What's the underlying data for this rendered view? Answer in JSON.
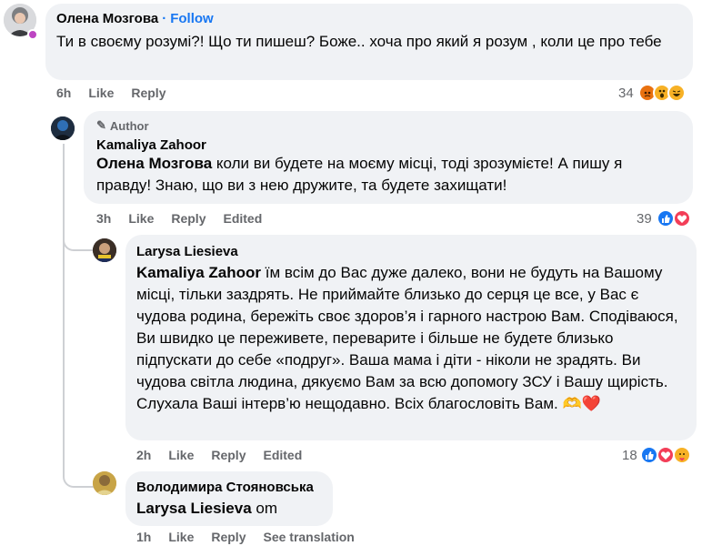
{
  "comments": [
    {
      "author": "Олена Мозгова",
      "follow": "Follow",
      "text": "Ти в своєму розумі?! Що ти пишеш? Боже.. хоча про який я розум , коли це про тебе",
      "time": "6h",
      "like": "Like",
      "reply": "Reply",
      "reactions_count": "34",
      "reactions": [
        "angry",
        "wow",
        "haha"
      ]
    },
    {
      "badge": "Author",
      "author": "Kamaliya Zahoor",
      "mention": "Олена Мозгова",
      "text": " коли ви будете на моєму місці, тоді зрозумієте! А пишу я правду! Знаю, що ви з нею дружите, та будете захищати!",
      "time": "3h",
      "like": "Like",
      "reply": "Reply",
      "edited": "Edited",
      "reactions_count": "39",
      "reactions": [
        "like",
        "love"
      ]
    },
    {
      "author": "Larysa Liesieva",
      "mention": "Kamaliya Zahoor",
      "text": " їм всім до Вас дуже далеко, вони не будуть на Вашому місці, тільки заздрять. Не приймайте близько до серця це все, у Вас є чудова родина, бережіть своє здоров’я і гарного настрою Вам. Сподіваюся, Ви швидко це переживете, переварите і більше не будете близько підпускати до себе «подруг». Ваша мама і діти - ніколи не зрадять. Ви чудова світла людина, дякуємо Вам за всю допомогу ЗСУ і Вашу щирість. Слухала Ваші інтерв’ю нещодавно. Всіх благословіть Вам.",
      "emoji": "🫶❤️",
      "time": "2h",
      "like": "Like",
      "reply": "Reply",
      "edited": "Edited",
      "reactions_count": "18",
      "reactions": [
        "like",
        "love",
        "care"
      ]
    },
    {
      "author": "Володимира Стояновська",
      "mention": "Larysa Liesieva",
      "text": " om",
      "time": "1h",
      "like": "Like",
      "reply": "Reply",
      "translation": "See translation"
    }
  ],
  "colors": {
    "bubble": "#f0f2f5",
    "link": "#1877f2",
    "meta": "#65676b",
    "like": "#1877f2",
    "love": "#f33e58",
    "angry": "#e9710f",
    "wow": "#f7b125"
  }
}
